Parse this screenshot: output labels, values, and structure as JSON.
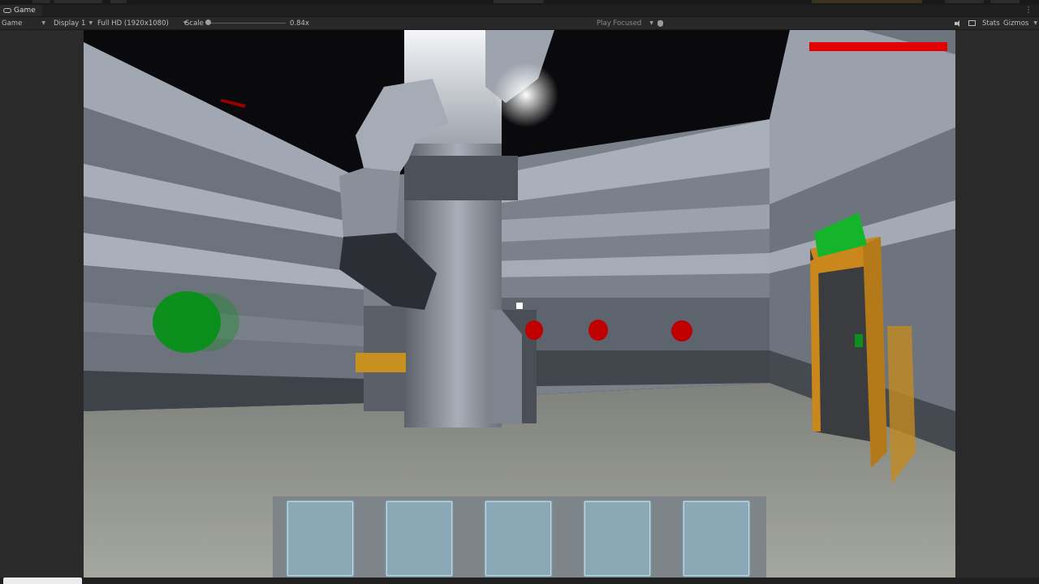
{
  "window": {
    "tab_title": "Game",
    "tab_icon": "gamepad-icon"
  },
  "toolbar": {
    "view_mode": "Game",
    "display": "Display 1",
    "resolution": "Full HD (1920x1080)",
    "scale_label": "Scale",
    "scale_value": "0.84x",
    "play_mode": "Play Focused",
    "stats_label": "Stats",
    "gizmos_label": "Gizmos",
    "icons": [
      "bug-icon",
      "speaker-icon",
      "stats-icon"
    ]
  },
  "hud": {
    "health_fraction": 1.0,
    "health_color": "#e40000",
    "hotbar_slot_count": 5,
    "slot_color": "#8aa8b6"
  },
  "scene_colors": {
    "wall": "#9aa1ad",
    "floor": "#8d9089",
    "button_green": "#0c8f1d",
    "button_red": "#c00000",
    "door_frame": "#c9871c"
  }
}
